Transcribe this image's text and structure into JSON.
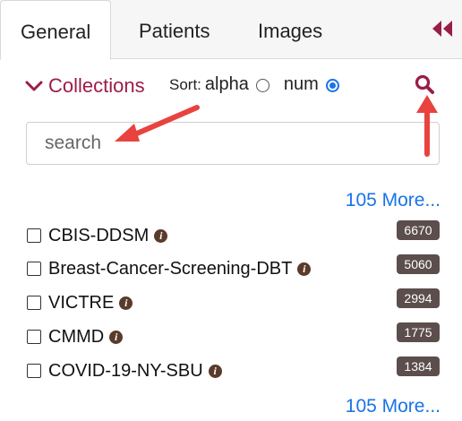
{
  "tabs": [
    {
      "label": "General"
    },
    {
      "label": "Patients"
    },
    {
      "label": "Images"
    }
  ],
  "collections": {
    "title": "Collections",
    "sort_label": "Sort:",
    "sort_options": [
      {
        "label": "alpha",
        "selected": false
      },
      {
        "label": "num",
        "selected": true
      }
    ]
  },
  "search": {
    "placeholder": "search",
    "value": ""
  },
  "more_top": "105 More...",
  "more_bottom": "105 More...",
  "items": [
    {
      "label": "CBIS-DDSM",
      "count": "6670"
    },
    {
      "label": "Breast-Cancer-Screening-DBT",
      "count": "5060"
    },
    {
      "label": "VICTRE",
      "count": "2994"
    },
    {
      "label": "CMMD",
      "count": "1775"
    },
    {
      "label": "COVID-19-NY-SBU",
      "count": "1384"
    }
  ],
  "colors": {
    "accent": "#9b1c48",
    "link": "#1a73e8",
    "badge": "#5b4e4c",
    "arrow": "#e8433e"
  },
  "icons": {
    "collapse": "double-chevron-left-icon",
    "search": "magnifier-icon",
    "info": "info-icon",
    "expand": "chevron-down-icon"
  }
}
